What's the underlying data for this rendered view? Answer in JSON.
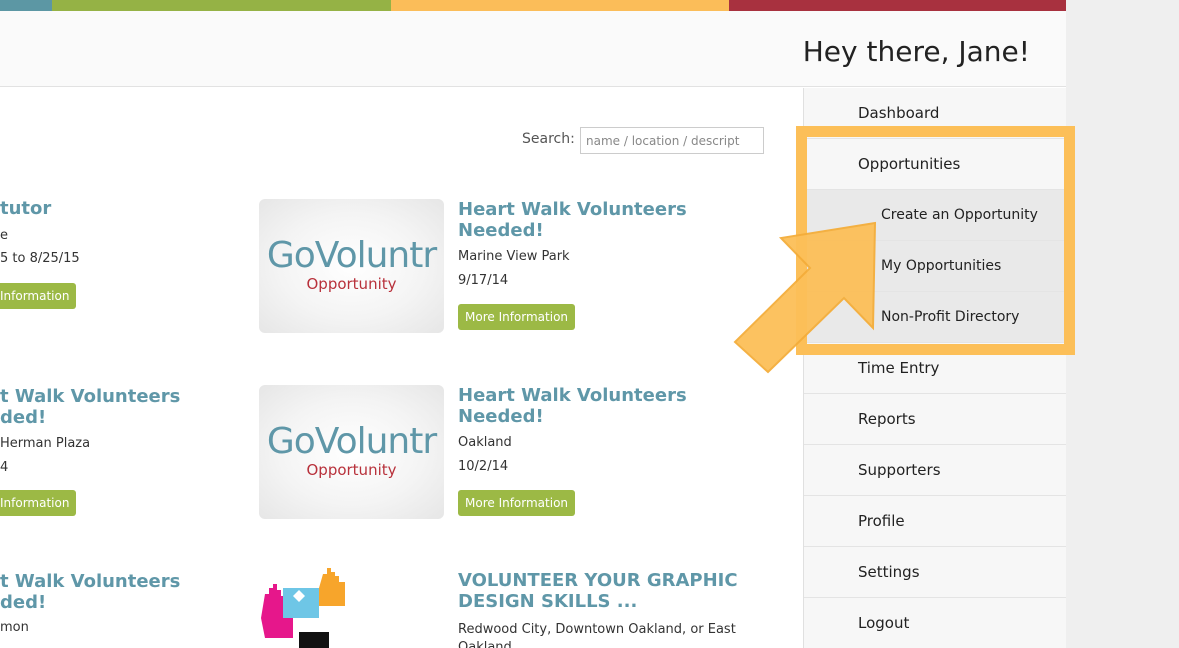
{
  "colors": {
    "stripe": [
      "#5c97a4",
      "#95b245",
      "#fbbd59",
      "#a8313f"
    ],
    "accent_blue": "#5f97a8",
    "button_green": "#9cb945",
    "highlight": "#fcbf58"
  },
  "header": {
    "greeting": "Hey there, Jane!"
  },
  "search": {
    "label": "Search:",
    "placeholder": "name / location / descript"
  },
  "logo": {
    "brand_go": "Go",
    "brand_rest": "Voluntr",
    "sub": "Opportunity"
  },
  "left_column": [
    {
      "title_line1": "tutor",
      "title_line2": "",
      "line1": "e",
      "line2": "5 to 8/25/15",
      "button": "Information"
    },
    {
      "title_line1": "t Walk Volunteers",
      "title_line2": "ded!",
      "line1": "Herman Plaza",
      "line2": "4",
      "button": "Information"
    },
    {
      "title_line1": "t Walk Volunteers",
      "title_line2": "ded!",
      "line1": "mon"
    }
  ],
  "right_column": [
    {
      "title_line1": "Heart Walk Volunteers",
      "title_line2": "Needed!",
      "location": "Marine View Park",
      "date": "9/17/14",
      "button": "More Information"
    },
    {
      "title_line1": "Heart Walk Volunteers",
      "title_line2": "Needed!",
      "location": "Oakland",
      "date": "10/2/14",
      "button": "More Information"
    },
    {
      "title_line1": "VOLUNTEER YOUR GRAPHIC",
      "title_line2": "DESIGN SKILLS ...",
      "location": "Redwood City, Downtown Oakland, or East",
      "location2": "Oakland"
    }
  ],
  "sidebar": {
    "items": [
      {
        "label": "Dashboard"
      },
      {
        "label": "Opportunities"
      },
      {
        "label": "Create an Opportunity"
      },
      {
        "label": "My Opportunities"
      },
      {
        "label": "Non-Profit Directory"
      },
      {
        "label": "Time Entry"
      },
      {
        "label": "Reports"
      },
      {
        "label": "Supporters"
      },
      {
        "label": "Profile"
      },
      {
        "label": "Settings"
      },
      {
        "label": "Logout"
      }
    ]
  }
}
